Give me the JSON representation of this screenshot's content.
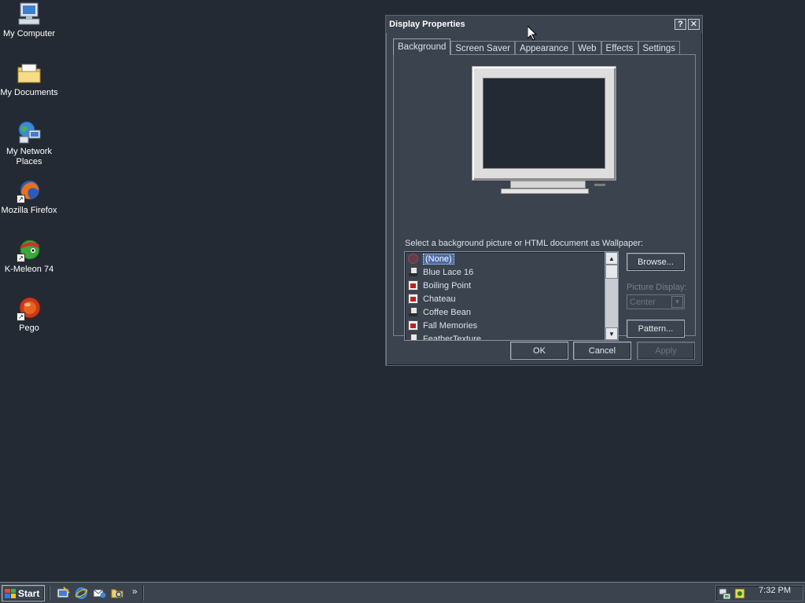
{
  "desktop": {
    "icons": [
      {
        "label": "My Computer",
        "icon": "computer-icon"
      },
      {
        "label": "My Documents",
        "icon": "folder-icon"
      },
      {
        "label_line1": "My Network",
        "label_line2": "Places",
        "icon": "network-icon"
      },
      {
        "label": "Mozilla Firefox",
        "icon": "firefox-icon"
      },
      {
        "label": "K-Meleon 74",
        "icon": "kmeleon-icon"
      },
      {
        "label": "Pego",
        "icon": "pego-icon"
      }
    ]
  },
  "window": {
    "title": "Display Properties",
    "help_label": "?",
    "close_label": "✕",
    "tabs": [
      "Background",
      "Screen Saver",
      "Appearance",
      "Web",
      "Effects",
      "Settings"
    ],
    "active_tab": "Background",
    "wallpaper_label": "Select a background picture or HTML document as Wallpaper:",
    "wallpapers": [
      {
        "name": "(None)",
        "type": "none",
        "selected": true
      },
      {
        "name": "Blue Lace 16",
        "type": "image"
      },
      {
        "name": "Boiling Point",
        "type": "doc"
      },
      {
        "name": "Chateau",
        "type": "doc"
      },
      {
        "name": "Coffee Bean",
        "type": "image"
      },
      {
        "name": "Fall Memories",
        "type": "doc"
      },
      {
        "name": "FeatherTexture",
        "type": "image"
      }
    ],
    "browse_label": "Browse...",
    "picture_display_label": "Picture Display:",
    "picture_display_value": "Center",
    "pattern_label": "Pattern...",
    "ok_label": "OK",
    "cancel_label": "Cancel",
    "apply_label": "Apply"
  },
  "taskbar": {
    "start_label": "Start",
    "chevron": "»",
    "clock": "7:32 PM"
  },
  "colors": {
    "desktop": "#232a33",
    "window": "#3a434e",
    "selection": "#4a6aa8"
  }
}
